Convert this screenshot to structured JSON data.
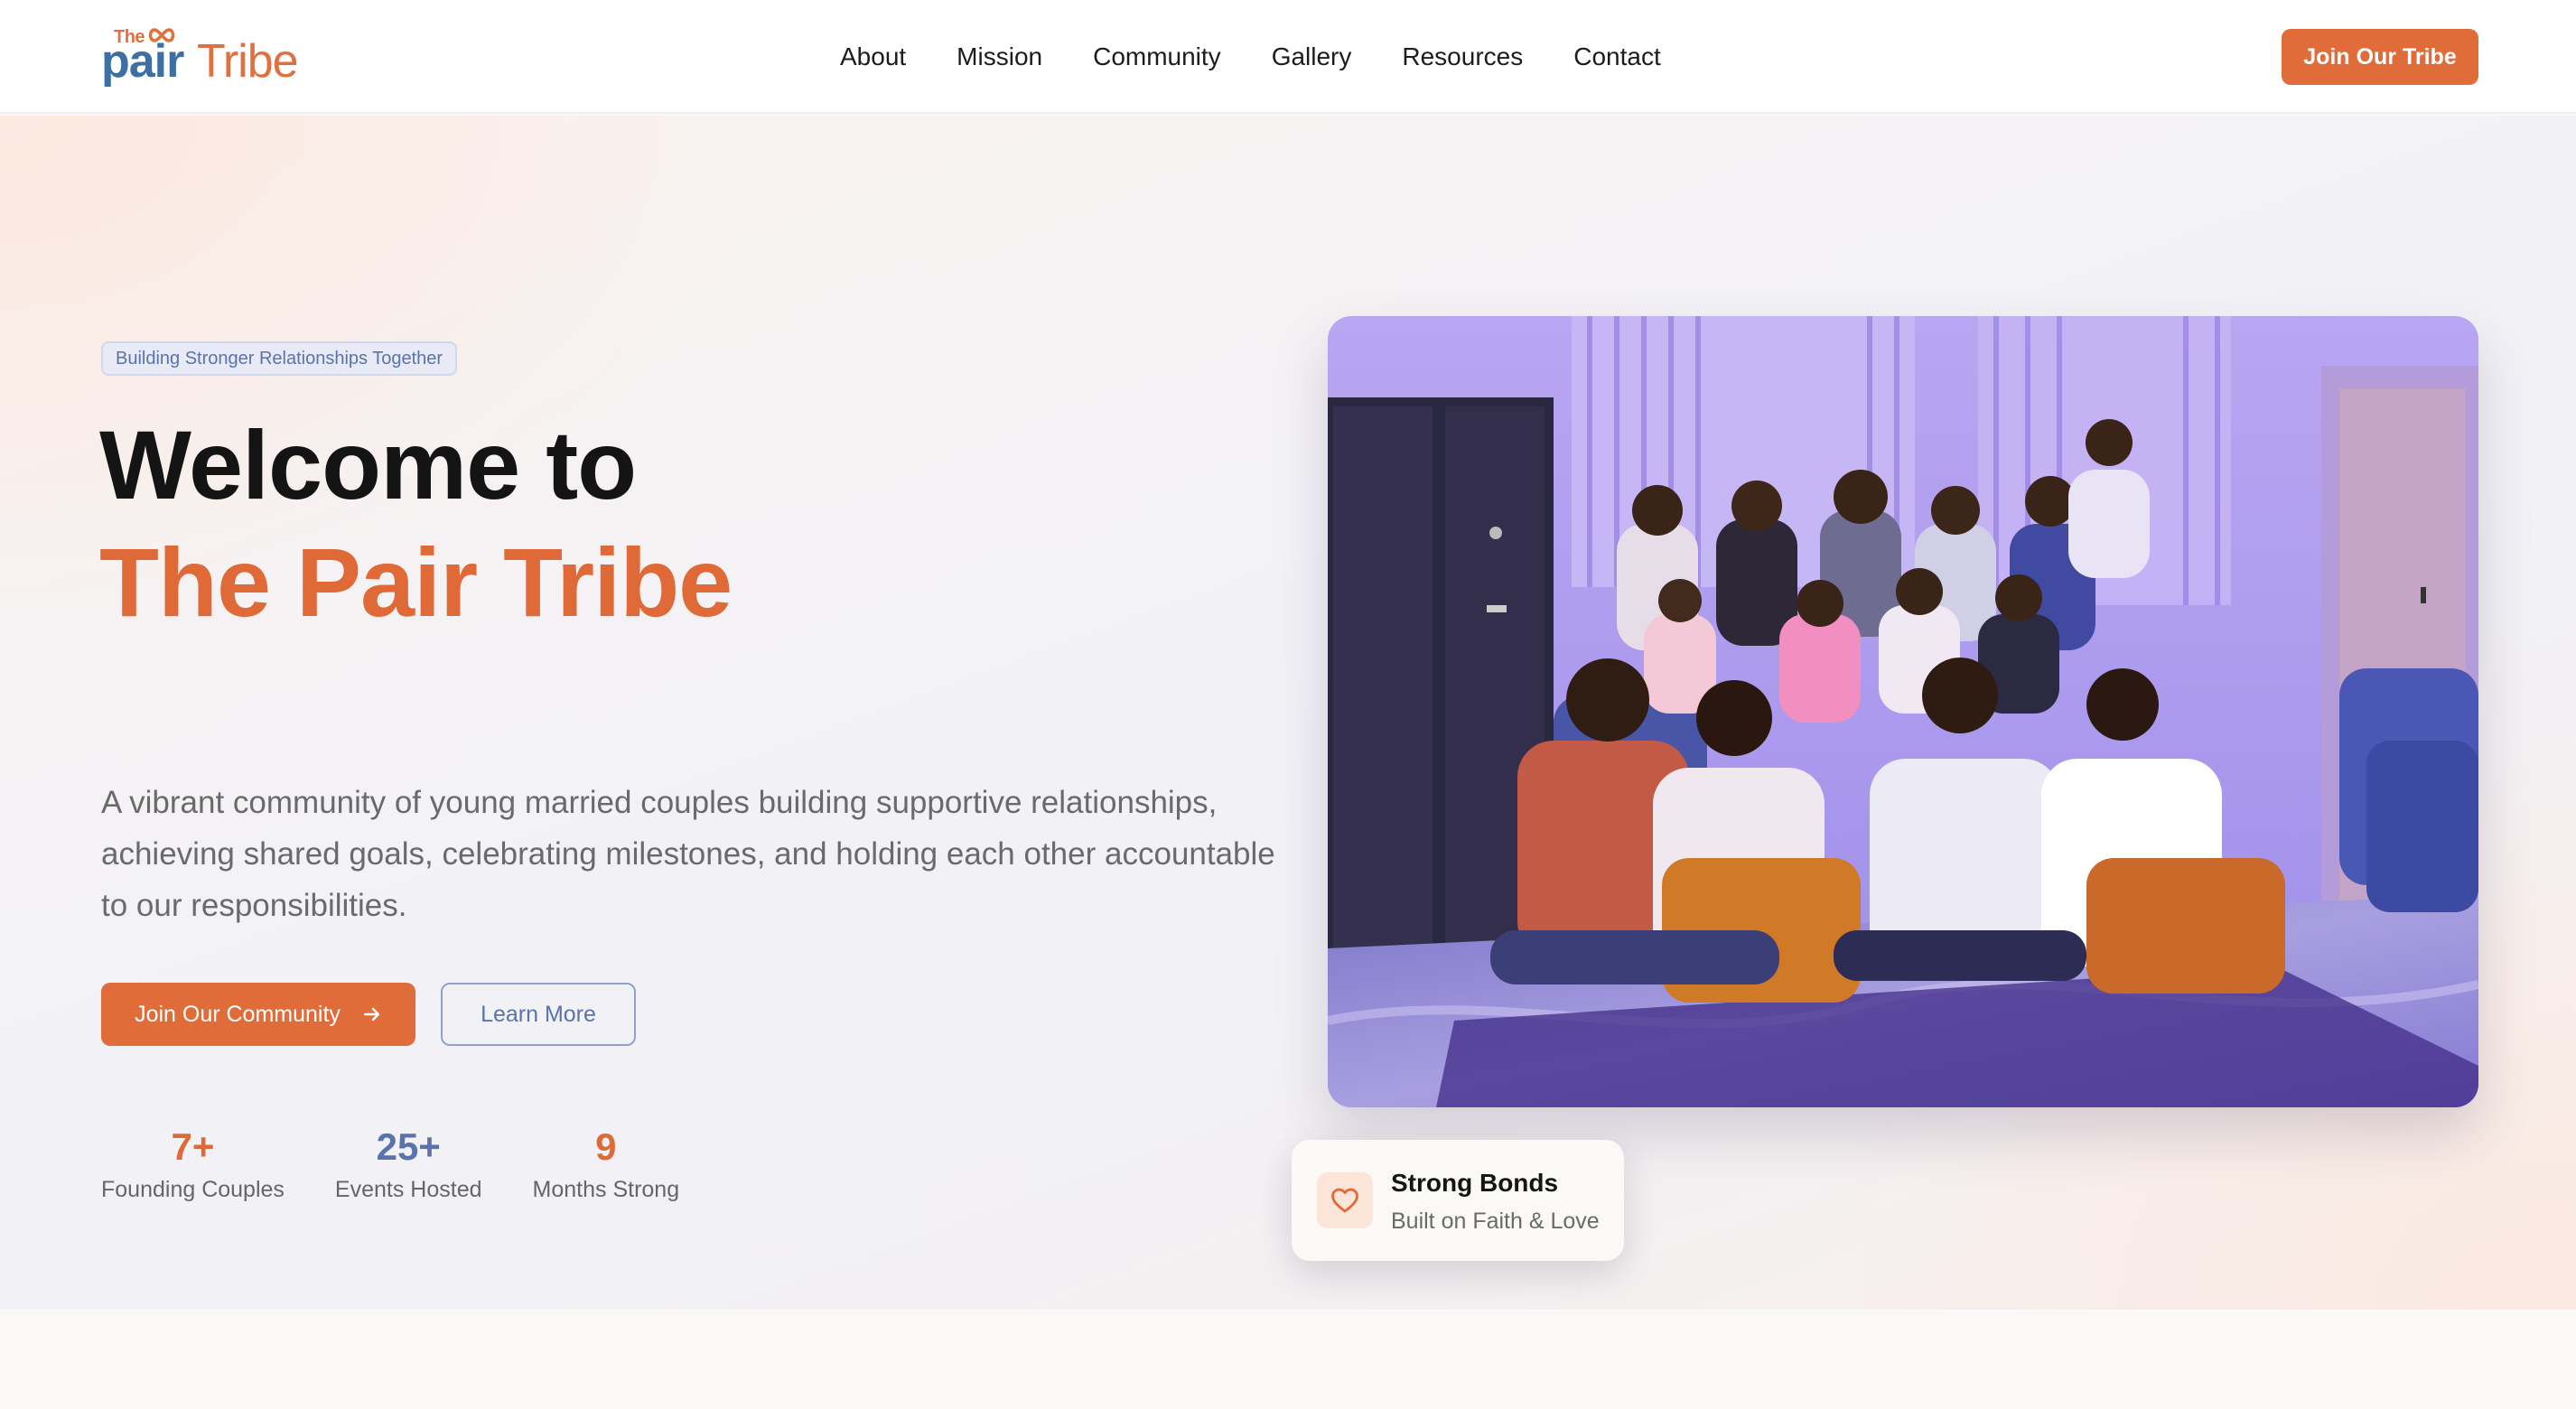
{
  "brand": {
    "logo_the": "The",
    "logo_pair": "pair",
    "logo_tribe": "Tribe"
  },
  "nav": {
    "links": [
      "About",
      "Mission",
      "Community",
      "Gallery",
      "Resources",
      "Contact"
    ],
    "cta_label": "Join Our Tribe"
  },
  "hero": {
    "badge": "Building Stronger Relationships Together",
    "title_line1": "Welcome to",
    "title_line2": "The Pair Tribe",
    "lead": "A vibrant community of young married couples building supportive relationships, achieving shared goals, celebrating milestones, and holding each other accountable to our responsibilities.",
    "primary_button": "Join Our Community",
    "secondary_button": "Learn More",
    "stats": [
      {
        "value": "7+",
        "label": "Founding Couples",
        "color": "#df6a38"
      },
      {
        "value": "25+",
        "label": "Events Hosted",
        "color": "#5a73ad"
      },
      {
        "value": "9",
        "label": "Months Strong",
        "color": "#df6a38"
      }
    ]
  },
  "photo_card": {
    "title": "Strong Bonds",
    "subtitle": "Built on Faith & Love"
  },
  "colors": {
    "accent": "#e06c3a",
    "secondary": "#5a73ad",
    "brand_blue": "#3e6fa3"
  },
  "icons": {
    "button_arrow": "arrow-right-icon",
    "card_icon": "heart-icon",
    "logo_mark": "infinity-icon"
  }
}
